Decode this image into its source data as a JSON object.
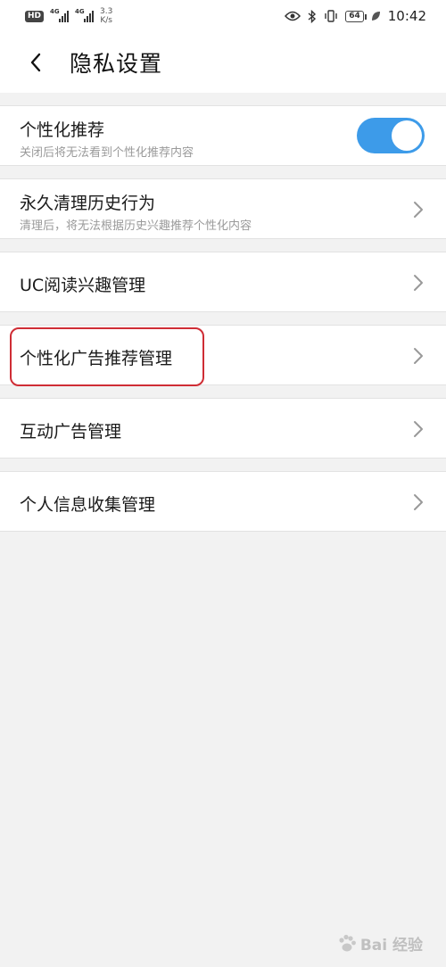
{
  "status_bar": {
    "hd": "HD",
    "sim1": "1",
    "net1": "4G",
    "net2": "4G",
    "speed_value": "3.3",
    "speed_unit": "K/s",
    "battery": "64",
    "time": "10:42"
  },
  "header": {
    "title": "隐私设置",
    "back_icon": "chevron-left-icon"
  },
  "settings": {
    "personalized": {
      "title": "个性化推荐",
      "subtitle": "关闭后将无法看到个性化推荐内容",
      "toggle_on": true,
      "toggle_color": "#3d9be9"
    },
    "clear_history": {
      "title": "永久清理历史行为",
      "subtitle": "清理后，将无法根据历史兴趣推荐个性化内容"
    },
    "uc_interest": {
      "title": "UC阅读兴趣管理"
    },
    "ad_recommend": {
      "title": "个性化广告推荐管理"
    },
    "interactive_ads": {
      "title": "互动广告管理"
    },
    "personal_info": {
      "title": "个人信息收集管理"
    }
  },
  "annotation": {
    "highlight_color": "#cf2d35"
  },
  "watermark": {
    "text": "Bai 经验"
  }
}
